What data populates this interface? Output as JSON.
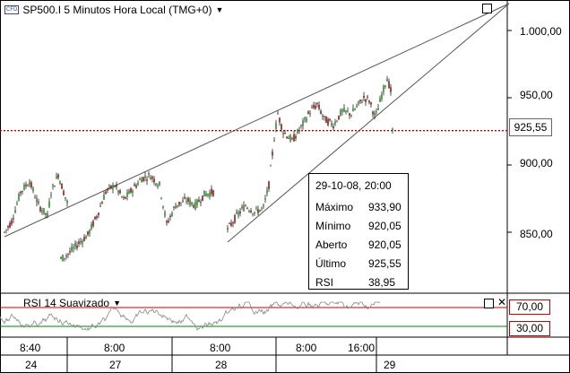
{
  "header": {
    "cfd_badge": "CFD",
    "title": "SP500.I 5 Minutos Hora Local (TMG+0)",
    "dropdown_icon": "caret-down-icon"
  },
  "price_axis": [
    "1.000,00",
    "950,00",
    "900,00",
    "850,00"
  ],
  "current_price": "925,55",
  "info_box": {
    "datetime": "29-10-08, 20:00",
    "rows": [
      {
        "label": "Máximo",
        "value": "933,90"
      },
      {
        "label": "Mínimo",
        "value": "920,05"
      },
      {
        "label": "Aberto",
        "value": "920,05"
      },
      {
        "label": "Último",
        "value": "925,55"
      },
      {
        "label": "RSI",
        "value": "38,95"
      }
    ]
  },
  "rsi_panel": {
    "title": "RSI 14 Suavizado",
    "upper": "70,00",
    "lower": "30,00",
    "upper_color": "#c00000",
    "lower_color": "#008000"
  },
  "time_axis": {
    "times": [
      "8:40",
      "8:00",
      "8:00",
      "8:00",
      "16:00"
    ],
    "days": [
      "24",
      "27",
      "28",
      "29"
    ]
  },
  "colors": {
    "up_candle": "#2d8f2d",
    "down_candle": "#8b1a1a",
    "price_line": "#c00000",
    "trendline": "#555555"
  },
  "chart_data": {
    "type": "candlestick",
    "ylim": [
      820,
      1020
    ],
    "current_price": 925.55,
    "rsi_levels": [
      70,
      30
    ],
    "segments": [
      {
        "day": "24",
        "points": [
          [
            0,
            850
          ],
          [
            8,
            858
          ],
          [
            18,
            880
          ],
          [
            28,
            888
          ],
          [
            38,
            870
          ],
          [
            48,
            862
          ],
          [
            52,
            880
          ],
          [
            60,
            893
          ],
          [
            66,
            880
          ],
          [
            70,
            872
          ]
        ]
      },
      {
        "day": "27",
        "points": [
          [
            0,
            830
          ],
          [
            10,
            835
          ],
          [
            20,
            842
          ],
          [
            30,
            848
          ],
          [
            40,
            862
          ],
          [
            50,
            880
          ],
          [
            60,
            885
          ],
          [
            70,
            874
          ],
          [
            80,
            882
          ],
          [
            90,
            890
          ],
          [
            100,
            892
          ],
          [
            110,
            885
          ],
          [
            118,
            856
          ],
          [
            128,
            870
          ],
          [
            140,
            874
          ],
          [
            150,
            870
          ],
          [
            160,
            878
          ],
          [
            170,
            880
          ]
        ]
      },
      {
        "day": "28",
        "points": [
          [
            0,
            852
          ],
          [
            10,
            862
          ],
          [
            20,
            870
          ],
          [
            30,
            865
          ],
          [
            40,
            868
          ],
          [
            46,
            885
          ],
          [
            52,
            920
          ],
          [
            56,
            938
          ],
          [
            62,
            925
          ],
          [
            72,
            918
          ],
          [
            82,
            928
          ],
          [
            92,
            940
          ],
          [
            100,
            945
          ],
          [
            108,
            934
          ],
          [
            118,
            930
          ],
          [
            128,
            940
          ],
          [
            138,
            938
          ],
          [
            145,
            944
          ],
          [
            152,
            950
          ],
          [
            158,
            948
          ],
          [
            165,
            935
          ],
          [
            172,
            952
          ],
          [
            178,
            965
          ],
          [
            182,
            955
          ],
          [
            184,
            925
          ]
        ]
      }
    ]
  }
}
